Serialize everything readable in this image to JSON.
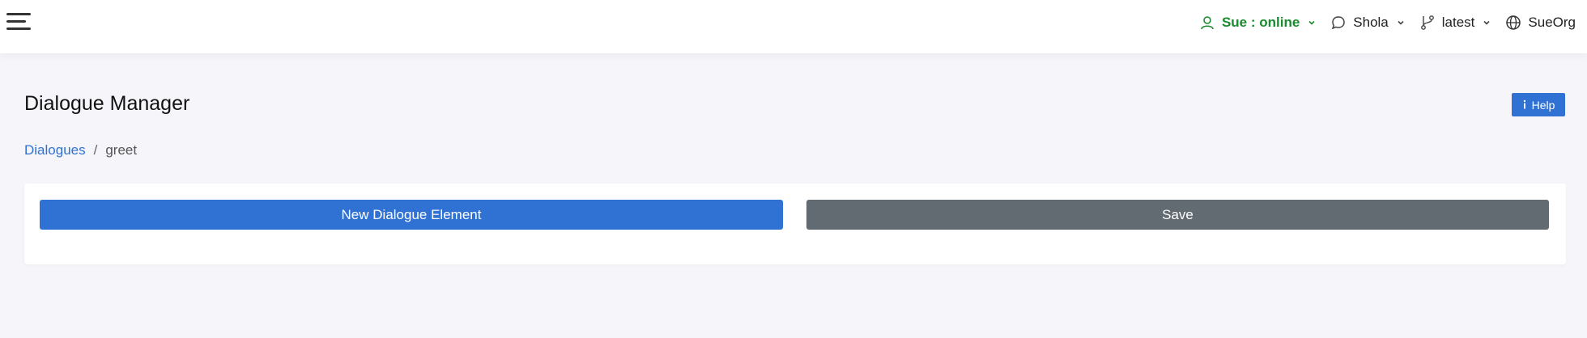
{
  "topnav": {
    "status_label": "Sue : online",
    "assistant_label": "Shola",
    "branch_label": "latest",
    "org_label": "SueOrg"
  },
  "page": {
    "title": "Dialogue Manager",
    "help_label": "Help"
  },
  "breadcrumb": {
    "parent": "Dialogues",
    "separator": "/",
    "current": "greet"
  },
  "actions": {
    "new_element_label": "New Dialogue Element",
    "save_label": "Save"
  },
  "colors": {
    "primary": "#2f72d4",
    "secondary": "#626b72",
    "status_online": "#1a8a2e"
  }
}
